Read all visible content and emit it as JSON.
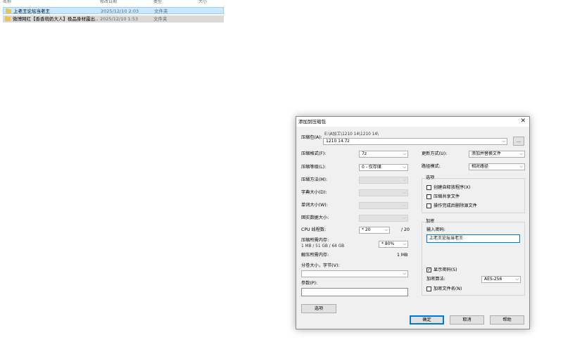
{
  "file_list": {
    "columns": [
      "名称",
      "修改日期",
      "类型",
      "大小"
    ],
    "rows": [
      {
        "name": "上老王论坛当老王",
        "date": "2025/12/10 2:03",
        "type": "文件夹"
      },
      {
        "name": "微博网红【香香萌奶大人】极品身材露出…",
        "date": "2025/12/10 1:53",
        "type": "文件夹"
      }
    ]
  },
  "dialog": {
    "title": "添加到压缩包",
    "close_glyph": "✕",
    "archive": {
      "label": "压缩包(A):",
      "path": "E:\\A加工\\1210 14\\1210 14\\",
      "value": "1210 14.7z",
      "browse_label": "..."
    },
    "left": {
      "format": {
        "label": "压缩格式(F):",
        "value": "7z"
      },
      "level": {
        "label": "压缩等级(L):",
        "value": "0 - 仅存储"
      },
      "method": {
        "label": "压缩方法(M):",
        "value": ""
      },
      "dict": {
        "label": "字典大小(D):",
        "value": ""
      },
      "word": {
        "label": "单词大小(W):",
        "value": ""
      },
      "solid": {
        "label": "固实数据大小:",
        "value": ""
      },
      "threads": {
        "label": "CPU 线程数:",
        "value": "* 20",
        "total": "/ 20"
      },
      "mem_compress": {
        "label": "压缩所需内存:",
        "detail": "1 MB / 51 GB / 64 GB",
        "value": "* 80%"
      },
      "mem_decompress": {
        "label": "解压所需内存:",
        "value": "1 MB"
      },
      "split": {
        "label": "分卷大小，字节(V):",
        "value": ""
      },
      "params": {
        "label": "参数(P):",
        "value": ""
      },
      "options_button": "选项"
    },
    "right": {
      "update": {
        "label": "更新方式(U):",
        "value": "添加并替换文件"
      },
      "path_mode": {
        "label": "路径模式:",
        "value": "相对路径"
      },
      "options_group": {
        "title": "选项",
        "items": [
          {
            "label": "创建自释放程序(X)",
            "checked": false
          },
          {
            "label": "压缩共享文件",
            "checked": false
          },
          {
            "label": "操作完成后删除源文件",
            "checked": false
          }
        ]
      },
      "encryption": {
        "title": "加密",
        "password_label": "输入密码:",
        "password_value": "上老王论坛当老王",
        "show_password": {
          "label": "显示密码(S)",
          "checked": true
        },
        "method_label": "加密算法:",
        "method_value": "AES-256",
        "encrypt_names": {
          "label": "加密文件名(N)",
          "checked": false
        }
      }
    },
    "buttons": {
      "ok": "确定",
      "cancel": "取消",
      "help": "帮助"
    }
  }
}
